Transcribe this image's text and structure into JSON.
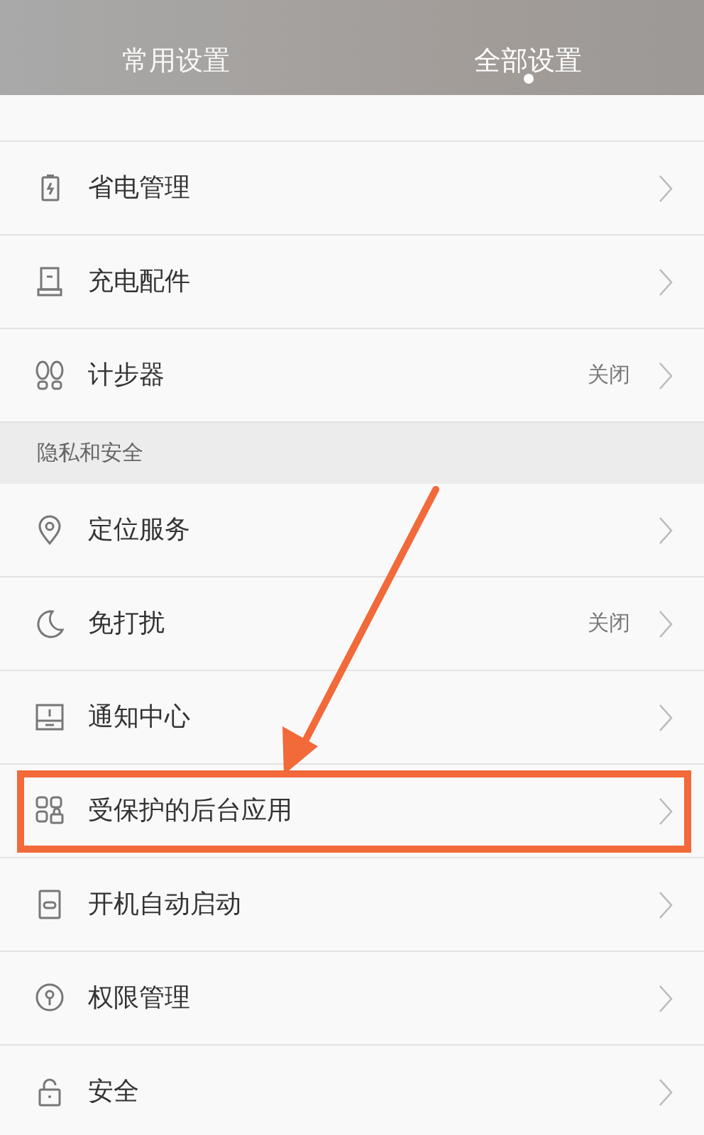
{
  "tabs": [
    {
      "label": "常用设置",
      "selected": false
    },
    {
      "label": "全部设置",
      "selected": true
    }
  ],
  "sections": [
    {
      "items": [
        {
          "label": "省电管理",
          "highlighted": false
        },
        {
          "label": "充电配件",
          "highlighted": false
        },
        {
          "label": "计步器",
          "value": "关闭",
          "highlighted": false
        }
      ]
    },
    {
      "title": "隐私和安全",
      "items": [
        {
          "label": "定位服务",
          "highlighted": false
        },
        {
          "label": "免打扰",
          "value": "关闭",
          "highlighted": false
        },
        {
          "label": "通知中心",
          "highlighted": false
        },
        {
          "label": "受保护的后台应用",
          "highlighted": true
        },
        {
          "label": "开机自动启动",
          "highlighted": false
        },
        {
          "label": "权限管理",
          "highlighted": false
        },
        {
          "label": "安全",
          "highlighted": false
        }
      ]
    }
  ],
  "annotation": {
    "kind": "arrow"
  }
}
